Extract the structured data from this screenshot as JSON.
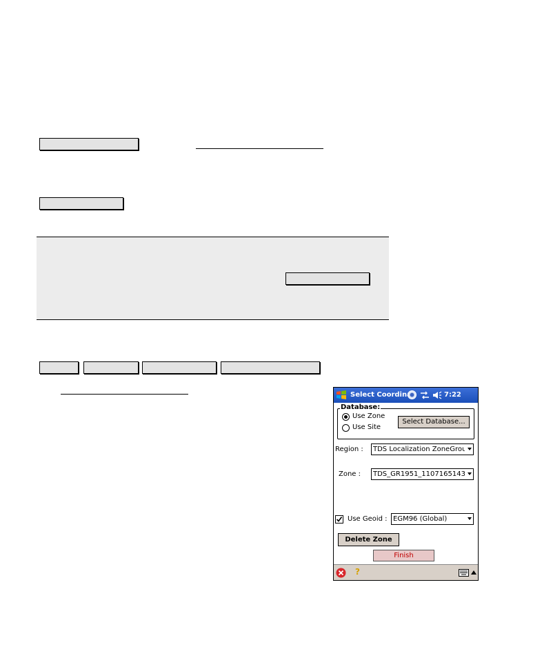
{
  "pda": {
    "title": "Select Coordina",
    "clock": "7:22",
    "database_group_label": "Database:",
    "use_zone_label": "Use  Zone",
    "use_site_label": "Use Site",
    "select_database_label": "Select Database...",
    "region_label": "Region :",
    "region_value": "TDS Localization ZoneGroup",
    "zone_label": "Zone :",
    "zone_value": "TDS_GR1951_1107165143",
    "use_geoid_label": "Use Geoid :",
    "geoid_value": "EGM96 (Global)",
    "delete_zone_label": "Delete Zone",
    "finish_label": "Finish",
    "help_glyph": "?",
    "colors": {
      "titlebar": "#2a5fcc",
      "finish_text": "#c00000",
      "finish_bg": "#e8c8c8",
      "bottom_bar": "#d8d0c8"
    },
    "icons": [
      "windows-logo-icon",
      "sync-icon",
      "connection-icon",
      "speaker-icon",
      "close-icon",
      "help-icon",
      "keyboard-icon",
      "up-arrow-icon"
    ],
    "use_zone_selected": true,
    "use_geoid_checked": true
  }
}
